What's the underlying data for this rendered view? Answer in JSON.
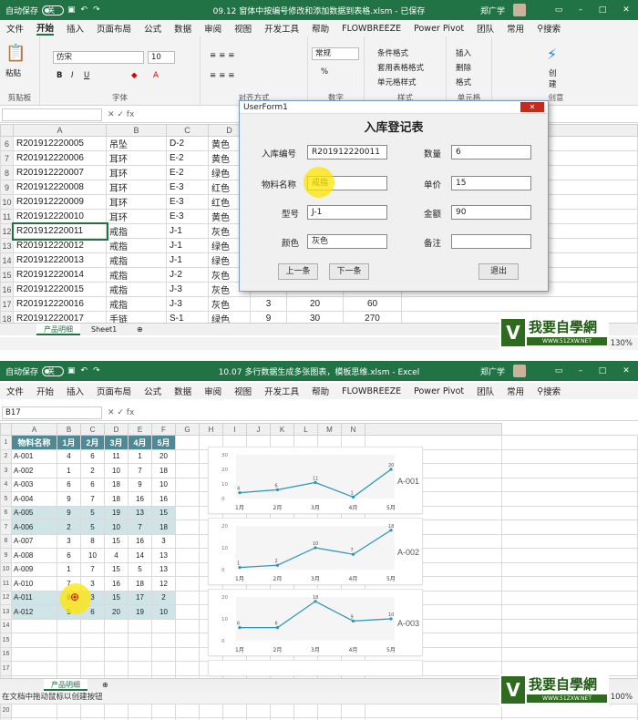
{
  "top": {
    "autosave": "自动保存",
    "toggle": "关",
    "title": "09.12 窗体中按编号修改和添加数据到表格.xlsm - 已保存",
    "user": "郑广学",
    "menus": [
      "文件",
      "开始",
      "插入",
      "页面布局",
      "公式",
      "数据",
      "审阅",
      "视图",
      "开发工具",
      "帮助",
      "FLOWBREEZE",
      "Power Pivot",
      "团队",
      "常用"
    ],
    "search": "搜索",
    "ribbon": {
      "paste": "粘贴",
      "clipboard": "剪贴板",
      "font_name": "仿宋",
      "font_size": "10",
      "font": "字体",
      "align": "对齐方式",
      "numfmt": "常规",
      "number": "数字",
      "cond": "条件格式",
      "table": "套用表格格式",
      "cellstyle": "单元格样式",
      "styles": "样式",
      "insert": "插入",
      "delete": "删除",
      "format": "格式",
      "cells": "单元格",
      "create": "创\n建",
      "ai": "创意"
    },
    "cols": [
      "",
      "A",
      "B",
      "C",
      "D",
      "E",
      "F",
      "G"
    ],
    "rows": [
      {
        "n": "6",
        "a": "R201912220005",
        "b": "吊坠",
        "c": "D-2",
        "d": "黄色"
      },
      {
        "n": "7",
        "a": "R201912220006",
        "b": "耳环",
        "c": "E-2",
        "d": "黄色"
      },
      {
        "n": "8",
        "a": "R201912220007",
        "b": "耳环",
        "c": "E-2",
        "d": "绿色"
      },
      {
        "n": "9",
        "a": "R201912220008",
        "b": "耳环",
        "c": "E-3",
        "d": "红色"
      },
      {
        "n": "10",
        "a": "R201912220009",
        "b": "耳环",
        "c": "E-3",
        "d": "红色"
      },
      {
        "n": "11",
        "a": "R201912220010",
        "b": "耳环",
        "c": "E-3",
        "d": "黄色"
      },
      {
        "n": "12",
        "a": "R201912220011",
        "b": "戒指",
        "c": "J-1",
        "d": "灰色"
      },
      {
        "n": "13",
        "a": "R201912220012",
        "b": "戒指",
        "c": "J-1",
        "d": "绿色"
      },
      {
        "n": "14",
        "a": "R201912220013",
        "b": "戒指",
        "c": "J-1",
        "d": "绿色"
      },
      {
        "n": "15",
        "a": "R201912220014",
        "b": "戒指",
        "c": "J-2",
        "d": "灰色"
      },
      {
        "n": "16",
        "a": "R201912220015",
        "b": "戒指",
        "c": "J-3",
        "d": "灰色"
      },
      {
        "n": "17",
        "a": "R201912220016",
        "b": "戒指",
        "c": "J-3",
        "d": "灰色",
        "e": "3",
        "f": "20",
        "g": "60"
      },
      {
        "n": "18",
        "a": "R201912220017",
        "b": "手链",
        "c": "S-1",
        "d": "绿色",
        "e": "9",
        "f": "30",
        "g": "270"
      }
    ],
    "sheets": [
      "产品明细",
      "Sheet1"
    ],
    "zoom": "130%",
    "form": {
      "caption": "UserForm1",
      "title": "入库登记表",
      "labels": {
        "id": "入库编号",
        "name": "物料名称",
        "model": "型号",
        "color": "颜色",
        "qty": "数量",
        "price": "单价",
        "amount": "金额",
        "note": "备注"
      },
      "values": {
        "id": "R201912220011",
        "name": "戒指",
        "model": "J-1",
        "color": "灰色",
        "qty": "6",
        "price": "15",
        "amount": "90",
        "note": ""
      },
      "buttons": {
        "prev": "上一条",
        "next": "下一条",
        "exit": "退出"
      }
    }
  },
  "logo": {
    "text": "我要自學網",
    "url": "WWW.51ZXW.NET"
  },
  "bottom": {
    "autosave": "自动保存",
    "toggle": "关",
    "title": "10.07 多行数据生成多张图表，模板思维.xlsm - Excel",
    "user": "郑广学",
    "menus": [
      "文件",
      "开始",
      "插入",
      "页面布局",
      "公式",
      "数据",
      "审阅",
      "视图",
      "开发工具",
      "帮助",
      "FLOWBREEZE",
      "Power Pivot",
      "团队",
      "常用"
    ],
    "search": "搜索",
    "namebox": "B17",
    "cols": [
      "",
      "A",
      "B",
      "C",
      "D",
      "E",
      "F",
      "G",
      "H",
      "I",
      "J",
      "K",
      "L",
      "M",
      "N"
    ],
    "header": [
      "物料名称",
      "1月",
      "2月",
      "3月",
      "4月",
      "5月"
    ],
    "table": [
      [
        "A-001",
        "4",
        "6",
        "11",
        "1",
        "20"
      ],
      [
        "A-002",
        "1",
        "2",
        "10",
        "7",
        "18"
      ],
      [
        "A-003",
        "6",
        "6",
        "18",
        "9",
        "10"
      ],
      [
        "A-004",
        "9",
        "7",
        "18",
        "16",
        "16"
      ],
      [
        "A-005",
        "9",
        "5",
        "19",
        "13",
        "15"
      ],
      [
        "A-006",
        "2",
        "5",
        "10",
        "7",
        "18"
      ],
      [
        "A-007",
        "3",
        "8",
        "15",
        "16",
        "3"
      ],
      [
        "A-008",
        "6",
        "10",
        "4",
        "14",
        "13"
      ],
      [
        "A-009",
        "1",
        "7",
        "15",
        "5",
        "13"
      ],
      [
        "A-010",
        "7",
        "3",
        "16",
        "18",
        "12"
      ],
      [
        "A-011",
        "8",
        "3",
        "15",
        "17",
        "2"
      ],
      [
        "A-012",
        "5",
        "6",
        "20",
        "19",
        "10"
      ]
    ],
    "status": "在文档中拖动鼠标以创建按钮",
    "sheets": [
      "产品明细"
    ],
    "zoom": "100%"
  },
  "chart_data": [
    {
      "type": "line",
      "title": "A-001",
      "categories": [
        "1月",
        "2月",
        "3月",
        "4月",
        "5月"
      ],
      "values": [
        4,
        6,
        11,
        1,
        20
      ],
      "yticks": [
        0,
        10,
        20,
        30
      ],
      "ylim": [
        0,
        30
      ]
    },
    {
      "type": "line",
      "title": "A-002",
      "categories": [
        "1月",
        "2月",
        "3月",
        "4月",
        "5月"
      ],
      "values": [
        1,
        2,
        10,
        7,
        18
      ],
      "yticks": [
        0,
        10,
        20
      ],
      "ylim": [
        0,
        20
      ]
    },
    {
      "type": "line",
      "title": "A-003",
      "categories": [
        "1月",
        "2月",
        "3月",
        "4月",
        "5月"
      ],
      "values": [
        6,
        6,
        18,
        9,
        10
      ],
      "yticks": [
        0,
        10,
        20
      ],
      "ylim": [
        0,
        20
      ]
    }
  ],
  "colors": {
    "green": "#217346",
    "teal": "#4e8a95",
    "teal_light": "#cfe4e7",
    "line": "#2a94b6"
  }
}
